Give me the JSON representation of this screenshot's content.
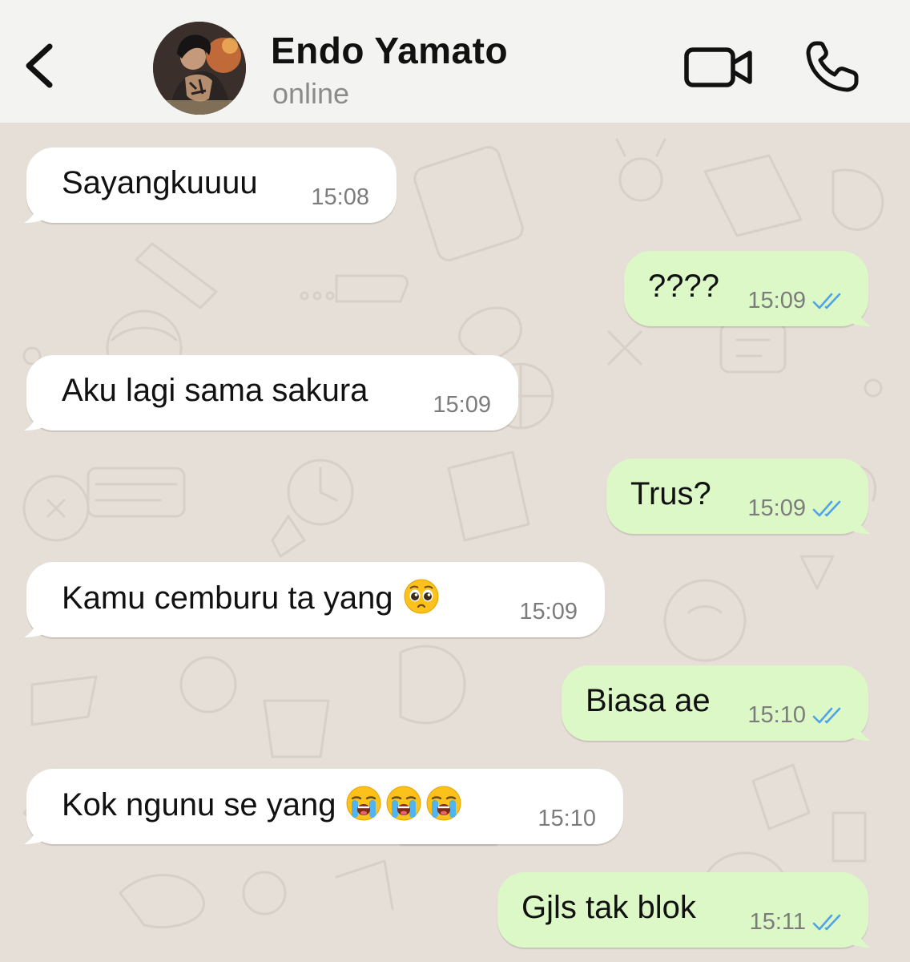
{
  "header": {
    "contact_name": "Endo Yamato",
    "status": "online",
    "back_icon": "chevron-left-icon",
    "video_icon": "video-camera-icon",
    "call_icon": "phone-icon"
  },
  "colors": {
    "incoming_bubble": "#ffffff",
    "outgoing_bubble": "#dcf8c6",
    "read_ticks": "#4fa3e8",
    "chat_background": "#e6dfd7"
  },
  "messages": [
    {
      "direction": "incoming",
      "text": "Sayangkuuuu",
      "time": "15:08"
    },
    {
      "direction": "outgoing",
      "text": "????",
      "time": "15:09",
      "status": "read"
    },
    {
      "direction": "incoming",
      "text": "Aku lagi sama sakura",
      "time": "15:09"
    },
    {
      "direction": "outgoing",
      "text": "Trus?",
      "time": "15:09",
      "status": "read"
    },
    {
      "direction": "incoming",
      "text": "Kamu cemburu ta yang",
      "emoji": [
        "pleading-face"
      ],
      "time": "15:09"
    },
    {
      "direction": "outgoing",
      "text": "Biasa ae",
      "time": "15:10",
      "status": "read"
    },
    {
      "direction": "incoming",
      "text": "Kok ngunu se yang",
      "emoji": [
        "loudly-crying-face",
        "loudly-crying-face",
        "loudly-crying-face"
      ],
      "time": "15:10"
    },
    {
      "direction": "outgoing",
      "text": "Gjls tak blok",
      "time": "15:11",
      "status": "read"
    }
  ]
}
